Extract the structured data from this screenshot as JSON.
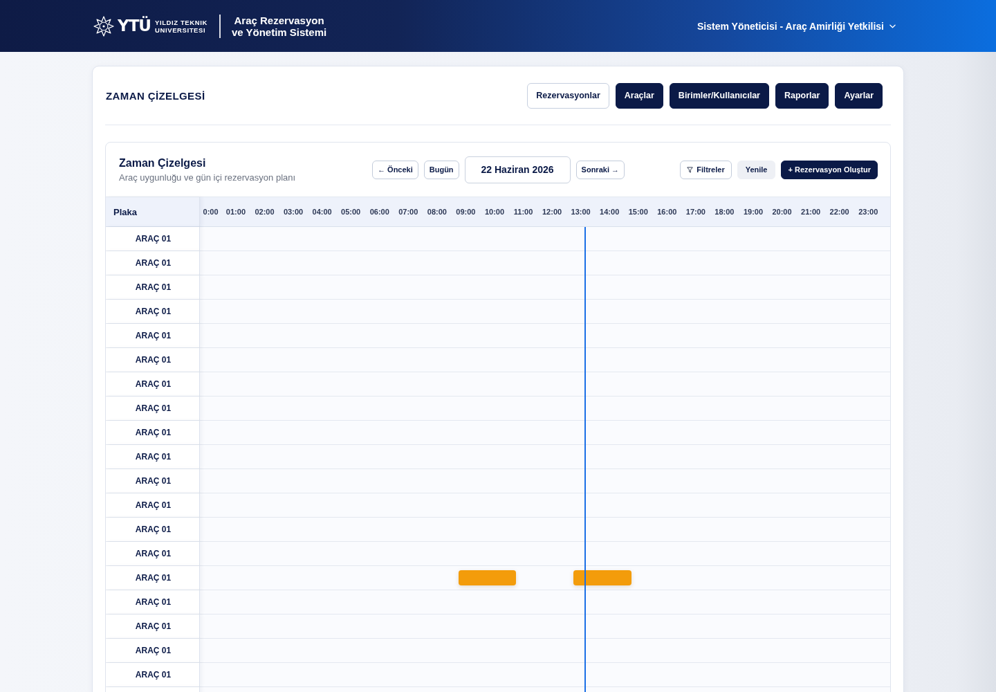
{
  "header": {
    "logo": {
      "mark": "YTÜ",
      "name_lines": [
        "YILDIZ TEKNIK",
        "UNIVERSITESI"
      ]
    },
    "app_title_lines": [
      "Araç Rezervasyon",
      "ve Yönetim Sistemi"
    ],
    "user_menu": {
      "label": "Sistem Yöneticisi - Araç Amirliği Yetkilisi"
    }
  },
  "page": {
    "title": "ZAMAN ÇİZELGESİ",
    "nav_buttons": [
      {
        "label": "Rezervasyonlar",
        "kind": "outline"
      },
      {
        "label": "Araçlar",
        "kind": "filled"
      },
      {
        "label": "Birimler/Kullanıcılar",
        "kind": "filled"
      },
      {
        "label": "Raporlar",
        "kind": "filled"
      },
      {
        "label": "Ayarlar",
        "kind": "filled"
      }
    ]
  },
  "schedule": {
    "title": "Zaman Çizelgesi",
    "subtitle": "Araç uygunluğu ve gün içi rezervasyon planı",
    "date_nav": {
      "previous": "← Önceki",
      "today": "Bugün",
      "date": "22 Haziran 2026",
      "next": "Sonraki →"
    },
    "actions": [
      {
        "label": "Filtreler",
        "kind": "filter"
      },
      {
        "label": "Yenile",
        "kind": "plain"
      },
      {
        "label": "+ Rezervasyon Oluştur",
        "kind": "primary"
      }
    ],
    "plate_header": "Plaka",
    "hours": [
      "0:00",
      "01:00",
      "02:00",
      "03:00",
      "04:00",
      "05:00",
      "06:00",
      "07:00",
      "08:00",
      "09:00",
      "10:00",
      "11:00",
      "12:00",
      "13:00",
      "14:00",
      "15:00",
      "16:00",
      "17:00",
      "18:00",
      "19:00",
      "20:00",
      "21:00",
      "22:00",
      "23:00"
    ],
    "now_marker": {
      "level": 0.56875
    },
    "rows": [
      {
        "plate": "ARAÇ 01",
        "reservations": []
      },
      {
        "plate": "ARAÇ 01",
        "reservations": []
      },
      {
        "plate": "ARAÇ 01",
        "reservations": []
      },
      {
        "plate": "ARAÇ 01",
        "reservations": []
      },
      {
        "plate": "ARAÇ 01",
        "reservations": []
      },
      {
        "plate": "ARAÇ 01",
        "reservations": []
      },
      {
        "plate": "ARAÇ 01",
        "reservations": []
      },
      {
        "plate": "ARAÇ 01",
        "reservations": []
      },
      {
        "plate": "ARAÇ 01",
        "reservations": []
      },
      {
        "plate": "ARAÇ 01",
        "reservations": []
      },
      {
        "plate": "ARAÇ 01",
        "reservations": []
      },
      {
        "plate": "ARAÇ 01",
        "reservations": []
      },
      {
        "plate": "ARAÇ 01",
        "reservations": []
      },
      {
        "plate": "ARAÇ 01",
        "reservations": []
      },
      {
        "plate": "ARAÇ 01",
        "reservations": [
          {
            "start": {
              "level": 0.385417
            },
            "end": {
              "level": 0.46875
            }
          },
          {
            "start": {
              "level": 0.552083
            },
            "end": {
              "level": 0.635417
            }
          }
        ]
      },
      {
        "plate": "ARAÇ 01",
        "reservations": []
      },
      {
        "plate": "ARAÇ 01",
        "reservations": []
      },
      {
        "plate": "ARAÇ 01",
        "reservations": []
      },
      {
        "plate": "ARAÇ 01",
        "reservations": []
      }
    ]
  }
}
